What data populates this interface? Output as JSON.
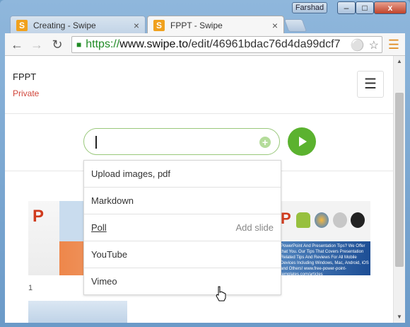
{
  "window": {
    "user": "Farshad",
    "controls": {
      "minimize": "–",
      "maximize": "□",
      "close": "x"
    }
  },
  "tabs": [
    {
      "favicon": "S",
      "label": "Creating - Swipe",
      "close": "×",
      "active": false
    },
    {
      "favicon": "S",
      "label": "FPPT - Swipe",
      "close": "×",
      "active": true
    }
  ],
  "toolbar": {
    "url_scheme": "https://",
    "url_host": "www.swipe.to",
    "url_path": "/edit/46961bdac76d4da99dcf7",
    "icons": [
      "back-icon",
      "forward-icon",
      "reload-icon",
      "lock-icon",
      "key-icon",
      "star-icon",
      "menu-icon"
    ]
  },
  "page": {
    "title": "FPPT",
    "privacy": "Private",
    "add_content_icon": "plus-icon",
    "play_icon": "play-icon"
  },
  "dropdown": {
    "items": [
      {
        "label": "Upload images, pdf",
        "hint": ""
      },
      {
        "label": "Markdown",
        "hint": ""
      },
      {
        "label": "Poll",
        "hint": "Add slide"
      },
      {
        "label": "YouTube",
        "hint": ""
      },
      {
        "label": "Vimeo",
        "hint": ""
      }
    ]
  },
  "slides": [
    {
      "number": "1",
      "text": "PowerPoint And Presentation Tips? We Offer that You. Our Tips That Covers Presentation Related Tips And Reviews For All Mobile Devices Including Windows, Mac, Android, iOS and Others! www.free-power-point-templates.com/articles"
    }
  ],
  "colors": {
    "accent_green": "#5bb22f",
    "private_red": "#d0453a",
    "favicon_orange": "#f0a11d",
    "secure_green": "#1f8b24"
  }
}
